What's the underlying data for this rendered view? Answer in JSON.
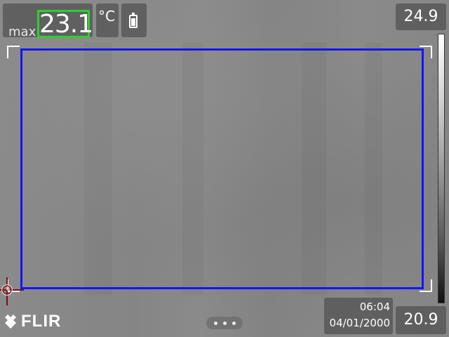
{
  "measurement": {
    "label": "max",
    "value": "23.1"
  },
  "unit": "°C",
  "battery": {
    "icon": "battery-icon"
  },
  "scale": {
    "max": "24.9",
    "min": "20.9"
  },
  "datetime": {
    "time": "06:04",
    "date": "04/01/2000"
  },
  "brand": {
    "name": "FLIR"
  },
  "colors": {
    "roi_border": "#1414ff",
    "measure_highlight": "#2fcf2f",
    "panel": "#505050"
  },
  "more_menu": {
    "icon": "more-dots-icon"
  }
}
